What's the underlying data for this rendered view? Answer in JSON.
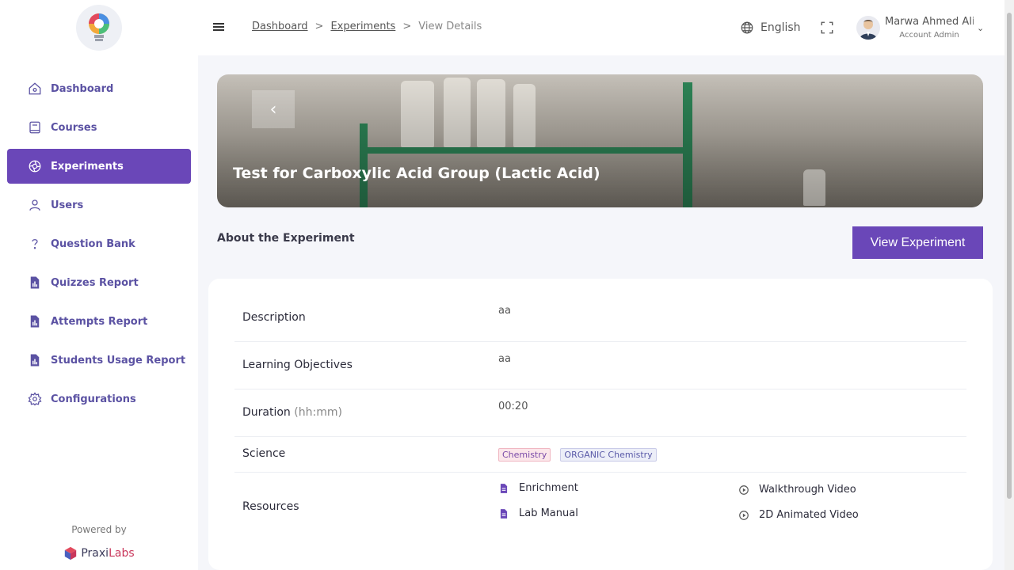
{
  "brand": {
    "powered_by": "Powered by",
    "name_part1": "Praxi",
    "name_part2": "Labs"
  },
  "sidebar": {
    "items": [
      {
        "label": "Dashboard",
        "icon": "home-icon",
        "active": false
      },
      {
        "label": "Courses",
        "icon": "book-icon",
        "active": false
      },
      {
        "label": "Experiments",
        "icon": "aperture-icon",
        "active": true
      },
      {
        "label": "Users",
        "icon": "user-icon",
        "active": false
      },
      {
        "label": "Question Bank",
        "icon": "question-icon",
        "active": false
      },
      {
        "label": "Quizzes Report",
        "icon": "report-icon",
        "active": false
      },
      {
        "label": "Attempts Report",
        "icon": "report-icon",
        "active": false
      },
      {
        "label": "Students Usage Report",
        "icon": "report-icon",
        "active": false
      },
      {
        "label": "Configurations",
        "icon": "gear-icon",
        "active": false
      }
    ]
  },
  "breadcrumb": {
    "items": [
      "Dashboard",
      "Experiments"
    ],
    "current": "View Details",
    "separator": ">"
  },
  "header": {
    "language": "English",
    "user_name": "Marwa Ahmed Ali",
    "user_role": "Account Admin"
  },
  "hero": {
    "title": "Test for Carboxylic Acid Group (Lactic Acid)"
  },
  "about": {
    "title": "About the Experiment",
    "view_button": "View Experiment"
  },
  "details": {
    "description_label": "Description",
    "description_value": "aa",
    "objectives_label": "Learning Objectives",
    "objectives_value": "aa",
    "duration_label": "Duration",
    "duration_hint": "(hh:mm)",
    "duration_value": "00:20",
    "science_label": "Science",
    "science_tags": [
      "Chemistry",
      "ORGANIC Chemistry"
    ],
    "resources_label": "Resources",
    "resources": {
      "enrichment": "Enrichment",
      "lab_manual": "Lab Manual",
      "walkthrough": "Walkthrough Video",
      "animated": "2D Animated Video"
    }
  },
  "colors": {
    "primary": "#6a47b8",
    "nav_text": "#5b52a3",
    "accent_green": "#2f8a5a"
  }
}
